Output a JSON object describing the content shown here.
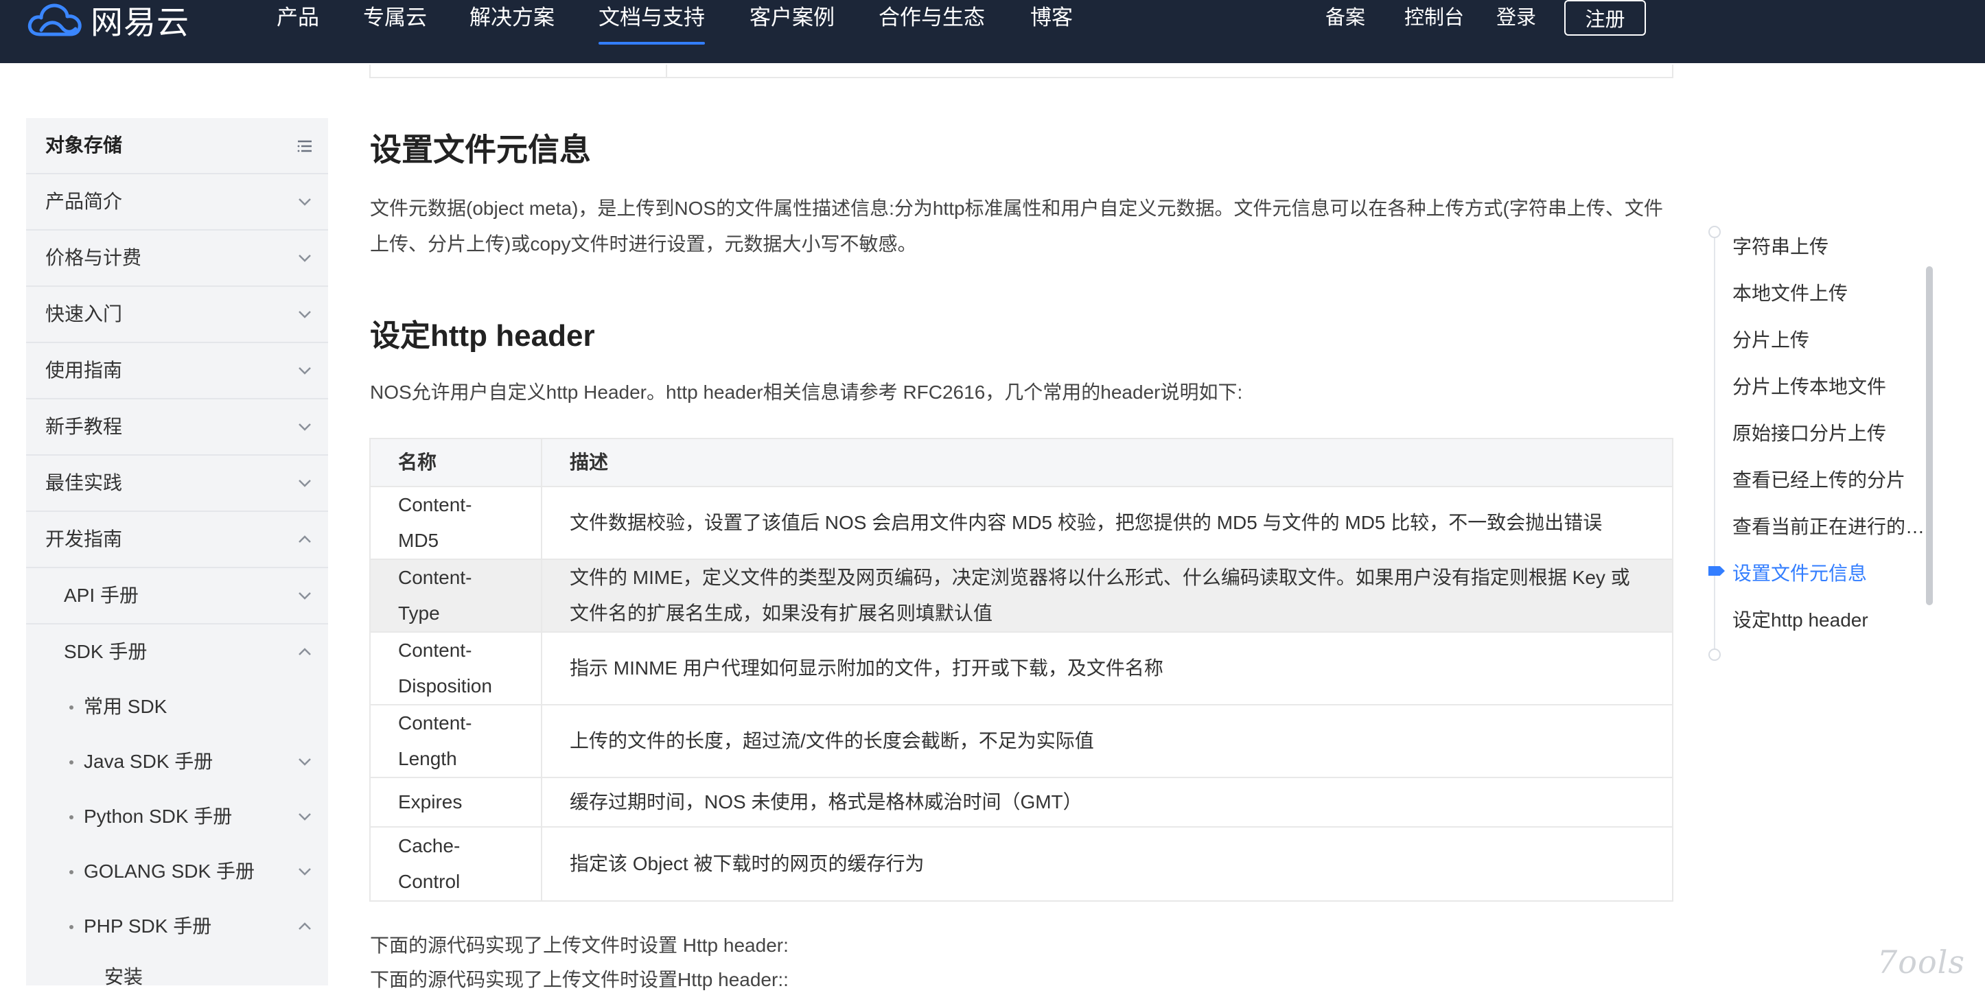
{
  "brand": {
    "name": "网易云"
  },
  "nav": {
    "items": [
      "产品",
      "专属云",
      "解决方案",
      "文档与支持",
      "客户案例",
      "合作与生态",
      "博客"
    ],
    "active": "文档与支持",
    "right": {
      "record": "备案",
      "console": "控制台",
      "login": "登录",
      "register": "注册"
    }
  },
  "sidebar": {
    "title": "对象存储",
    "items": [
      "产品简介",
      "价格与计费",
      "快速入门",
      "使用指南",
      "新手教程",
      "最佳实践",
      "开发指南"
    ],
    "sub": [
      "API 手册",
      "SDK 手册"
    ],
    "sdk": [
      "常用 SDK",
      "Java SDK 手册",
      "Python SDK 手册",
      "GOLANG SDK 手册",
      "PHP SDK 手册"
    ],
    "install": "安装"
  },
  "content": {
    "title": "设置文件元信息",
    "intro_line1": "文件元数据(object meta)，是上传到NOS的文件属性描述信息:分为http标准属性和用户自定义元数据。文件元信息可以在各种上传方式(字符串上传、文件",
    "intro_line2": "上传、分片上传)或copy文件时进行设置，元数据大小写不敏感。",
    "subtitle": "设定http header",
    "sub_intro": "NOS允许用户自定义http Header。http header相关信息请参考 RFC2616，几个常用的header说明如下:",
    "table": {
      "headers": [
        "名称",
        "描述"
      ],
      "rows": [
        {
          "name": [
            "Content-",
            "MD5"
          ],
          "desc": [
            "文件数据校验，设置了该值后 NOS 会启用文件内容 MD5 校验，把您提供的 MD5 与文件的 MD5 比较，不一致会抛出错误"
          ]
        },
        {
          "name": [
            "Content-",
            "Type"
          ],
          "desc": [
            "文件的 MIME，定义文件的类型及网页编码，决定浏览器将以什么形式、什么编码读取文件。如果用户没有指定则根据 Key 或",
            "文件名的扩展名生成，如果没有扩展名则填默认值"
          ]
        },
        {
          "name": [
            "Content-",
            "Disposition"
          ],
          "desc": [
            "指示 MINME 用户代理如何显示附加的文件，打开或下载，及文件名称"
          ]
        },
        {
          "name": [
            "Content-",
            "Length"
          ],
          "desc": [
            "上传的文件的长度，超过流/文件的长度会截断，不足为实际值"
          ]
        },
        {
          "name": [
            "Expires"
          ],
          "desc": [
            "缓存过期时间，NOS 未使用，格式是格林威治时间（GMT）"
          ]
        },
        {
          "name": [
            "Cache-",
            "Control"
          ],
          "desc": [
            "指定该 Object 被下载时的网页的缓存行为"
          ]
        }
      ]
    },
    "footer1": "下面的源代码实现了上传文件时设置 Http header:",
    "footer2": "下面的源代码实现了上传文件时设置Http header::"
  },
  "toc": {
    "items": [
      "字符串上传",
      "本地文件上传",
      "分片上传",
      "分片上传本地文件",
      "原始接口分片上传",
      "查看已经上传的分片",
      "查看当前正在进行的分片上传",
      "设置文件元信息",
      "设定http header"
    ],
    "active": "设置文件元信息"
  },
  "watermark": "7ools"
}
